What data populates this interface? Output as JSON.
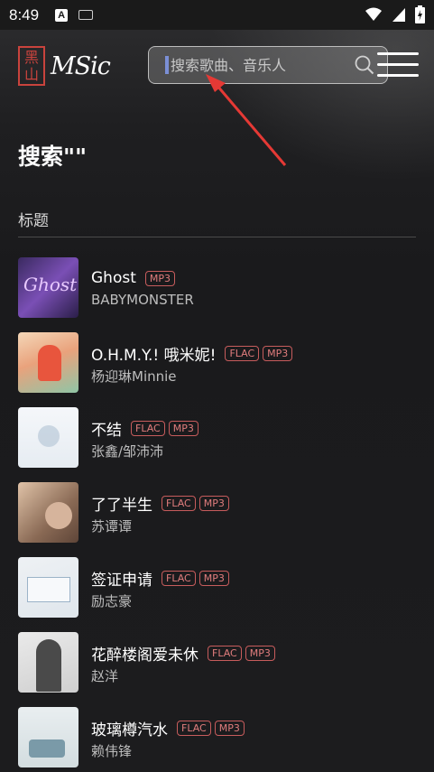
{
  "status_bar": {
    "time": "8:49",
    "app_badge": "A"
  },
  "header": {
    "logo_seal_top": "黑",
    "logo_seal_bottom": "山",
    "logo_word": "MSic",
    "search": {
      "placeholder": "搜索歌曲、音乐人",
      "value": ""
    }
  },
  "page": {
    "title": "搜索\"\"",
    "section_label": "标题"
  },
  "songs": [
    {
      "title": "Ghost",
      "artist": "BABYMONSTER",
      "tags": [
        "MP3"
      ],
      "cover_text": "Ghost"
    },
    {
      "title": "O.H.M.Y.! 哦米妮!",
      "artist": "杨迎琳Minnie",
      "tags": [
        "FLAC",
        "MP3"
      ]
    },
    {
      "title": "不结",
      "artist": "张鑫/邹沛沛",
      "tags": [
        "FLAC",
        "MP3"
      ]
    },
    {
      "title": "了了半生",
      "artist": "苏谭谭",
      "tags": [
        "FLAC",
        "MP3"
      ]
    },
    {
      "title": "签证申请",
      "artist": "励志豪",
      "tags": [
        "FLAC",
        "MP3"
      ]
    },
    {
      "title": "花醉楼阁爱未休",
      "artist": "赵洋",
      "tags": [
        "FLAC",
        "MP3"
      ]
    },
    {
      "title": "玻璃樽汽水",
      "artist": "赖伟锋",
      "tags": [
        "FLAC",
        "MP3"
      ]
    }
  ],
  "colors": {
    "accent_tag": "#c75c5c",
    "background": "#1c1c1e",
    "logo_red": "#c9433d"
  }
}
